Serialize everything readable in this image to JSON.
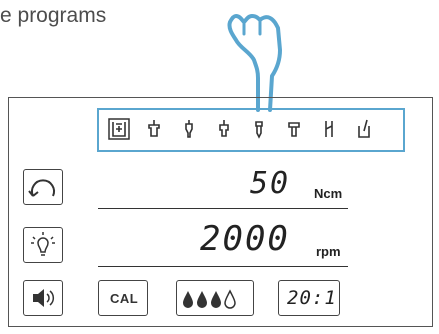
{
  "caption": "e programs",
  "programs": [
    {
      "icon": "program-1-icon",
      "selected": true
    },
    {
      "icon": "program-2-icon"
    },
    {
      "icon": "program-3-icon"
    },
    {
      "icon": "program-4-icon"
    },
    {
      "icon": "program-5-icon"
    },
    {
      "icon": "program-6-icon"
    },
    {
      "icon": "program-7-icon"
    },
    {
      "icon": "program-8-icon"
    }
  ],
  "torque": {
    "value": "50",
    "unit": "Ncm"
  },
  "speed": {
    "value": "2000",
    "unit": "rpm"
  },
  "buttons": {
    "direction": "rotation-direction-icon",
    "light": "light-bulb-icon",
    "sound": "speaker-icon",
    "calibrate_label": "CAL",
    "coolant": "coolant-drops-icon",
    "ratio": "20:1"
  }
}
